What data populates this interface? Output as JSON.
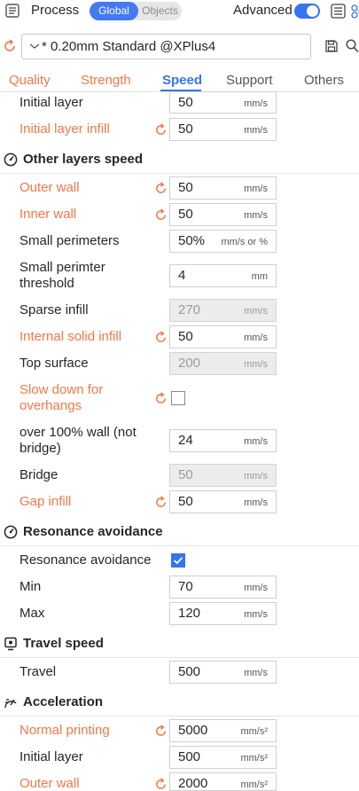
{
  "topbar": {
    "title": "Process",
    "mode_global": "Global",
    "mode_objects": "Objects",
    "advanced_label": "Advanced",
    "advanced_on": true,
    "accent_color": "#3674f0"
  },
  "preset": {
    "value": "* 0.20mm Standard @XPlus4"
  },
  "tabs": [
    {
      "label": "Quality"
    },
    {
      "label": "Strength"
    },
    {
      "label": "Speed"
    },
    {
      "label": "Support"
    },
    {
      "label": "Others"
    }
  ],
  "colors": {
    "modified": "#f07848",
    "accent": "#3674f0"
  },
  "settings": {
    "initial_layer": {
      "label": "Initial layer",
      "value": "50",
      "unit": "mm/s"
    },
    "initial_layer_infill": {
      "label": "Initial layer infill",
      "value": "50",
      "unit": "mm/s"
    },
    "other_group": {
      "title": "Other layers speed"
    },
    "outer_wall": {
      "label": "Outer wall",
      "value": "50",
      "unit": "mm/s"
    },
    "inner_wall": {
      "label": "Inner wall",
      "value": "50",
      "unit": "mm/s"
    },
    "small_perimeters": {
      "label": "Small perimeters",
      "value": "50%",
      "unit": "mm/s or %"
    },
    "small_perimeter_threshold": {
      "label_line1": "Small perimter",
      "label_line2": "threshold",
      "value": "4",
      "unit": "mm"
    },
    "sparse_infill": {
      "label": "Sparse infill",
      "value": "270",
      "unit": "mm/s"
    },
    "internal_solid_infill": {
      "label": "Internal solid infill",
      "value": "50",
      "unit": "mm/s"
    },
    "top_surface": {
      "label": "Top surface",
      "value": "200",
      "unit": "mm/s"
    },
    "slow_down_overhangs": {
      "label_line1": "Slow down for",
      "label_line2": "overhangs",
      "checked": false
    },
    "over_100_wall": {
      "label_line1": "over 100% wall (not",
      "label_line2": "bridge)",
      "value": "24",
      "unit": "mm/s"
    },
    "bridge": {
      "label": "Bridge",
      "value": "50",
      "unit": "mm/s"
    },
    "gap_infill": {
      "label": "Gap infill",
      "value": "50",
      "unit": "mm/s"
    },
    "resonance_group": {
      "title": "Resonance avoidance"
    },
    "resonance_avoidance": {
      "label": "Resonance avoidance",
      "checked": true
    },
    "min": {
      "label": "Min",
      "value": "70",
      "unit": "mm/s"
    },
    "max": {
      "label": "Max",
      "value": "120",
      "unit": "mm/s"
    },
    "travel_group": {
      "title": "Travel speed"
    },
    "travel": {
      "label": "Travel",
      "value": "500",
      "unit": "mm/s"
    },
    "accel_group": {
      "title": "Acceleration"
    },
    "normal_printing": {
      "label": "Normal printing",
      "value": "5000",
      "unit": "mm/s²"
    },
    "accel_initial_layer": {
      "label": "Initial layer",
      "value": "500",
      "unit": "mm/s²"
    },
    "accel_outer_wall": {
      "label": "Outer wall",
      "value": "2000",
      "unit": "mm/s²"
    }
  }
}
